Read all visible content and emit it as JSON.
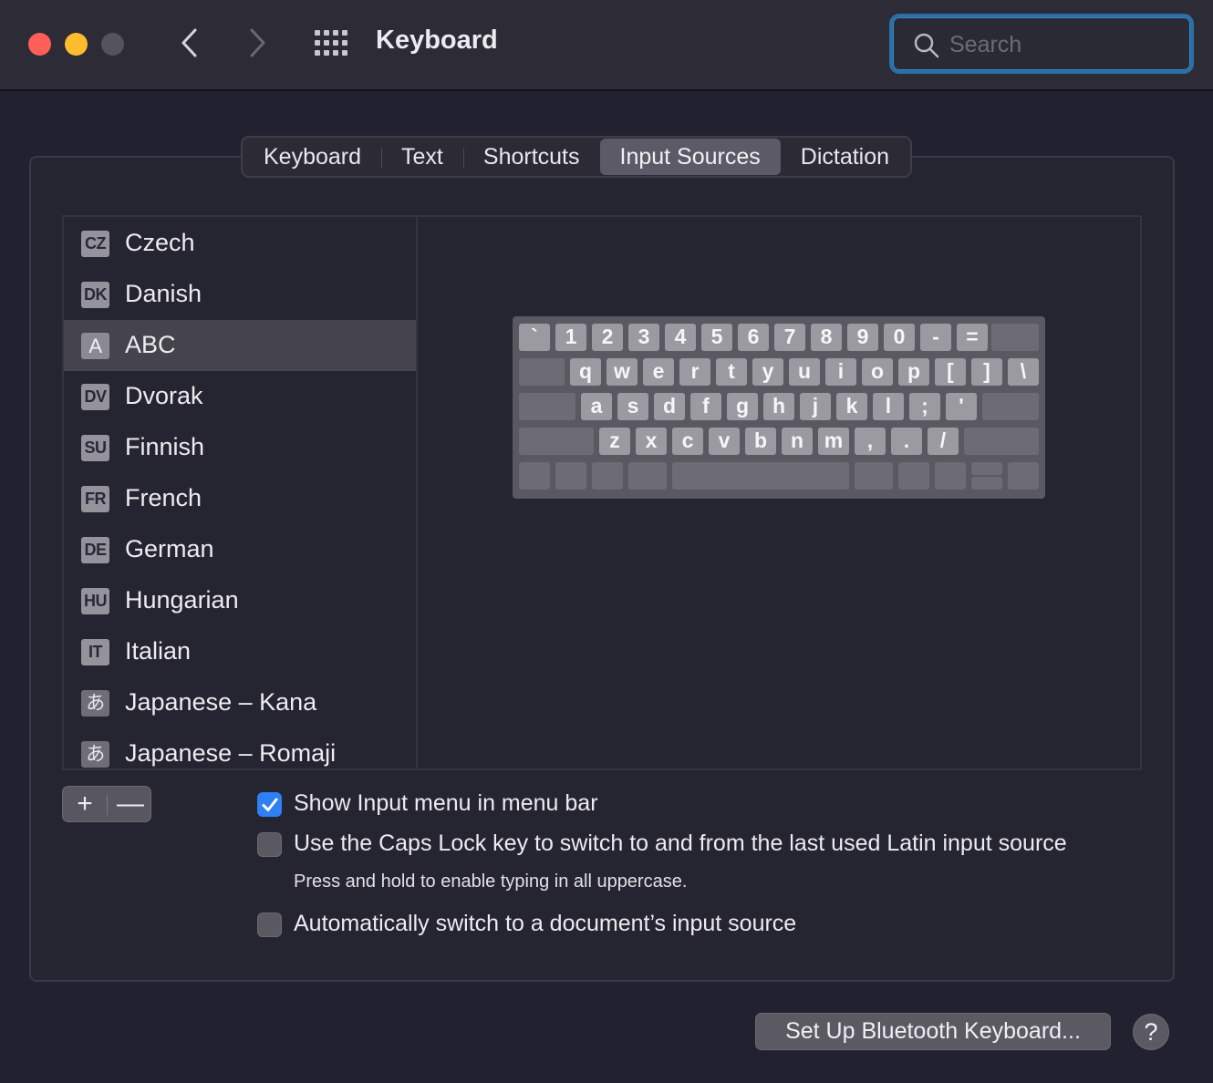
{
  "window": {
    "title": "Keyboard"
  },
  "search": {
    "placeholder": "Search",
    "value": ""
  },
  "tabs": [
    {
      "label": "Keyboard",
      "active": false
    },
    {
      "label": "Text",
      "active": false
    },
    {
      "label": "Shortcuts",
      "active": false
    },
    {
      "label": "Input Sources",
      "active": true
    },
    {
      "label": "Dictation",
      "active": false
    }
  ],
  "input_sources": [
    {
      "badge": "CZ",
      "label": "Czech"
    },
    {
      "badge": "DK",
      "label": "Danish"
    },
    {
      "badge": "A",
      "label": "ABC",
      "selected": true
    },
    {
      "badge": "DV",
      "label": "Dvorak"
    },
    {
      "badge": "SU",
      "label": "Finnish"
    },
    {
      "badge": "FR",
      "label": "French"
    },
    {
      "badge": "DE",
      "label": "German"
    },
    {
      "badge": "HU",
      "label": "Hungarian"
    },
    {
      "badge": "IT",
      "label": "Italian"
    },
    {
      "badge": "あ",
      "label": "Japanese – Kana"
    },
    {
      "badge": "あ",
      "label": "Japanese – Romaji"
    }
  ],
  "keyboard_rows": [
    [
      "`",
      "1",
      "2",
      "3",
      "4",
      "5",
      "6",
      "7",
      "8",
      "9",
      "0",
      "-",
      "="
    ],
    [
      "q",
      "w",
      "e",
      "r",
      "t",
      "y",
      "u",
      "i",
      "o",
      "p",
      "[",
      "]",
      "\\"
    ],
    [
      "a",
      "s",
      "d",
      "f",
      "g",
      "h",
      "j",
      "k",
      "l",
      ";",
      "'"
    ],
    [
      "z",
      "x",
      "c",
      "v",
      "b",
      "n",
      "m",
      ",",
      ".",
      "/"
    ]
  ],
  "list_controls": {
    "add": "+",
    "remove": "—"
  },
  "options": {
    "show_input_menu": {
      "label": "Show Input menu in menu bar",
      "checked": true
    },
    "caps_lock_switch": {
      "label": "Use the Caps Lock key to switch to and from the last used Latin input source",
      "checked": false,
      "note": "Press and hold to enable typing in all uppercase."
    },
    "auto_switch": {
      "label": "Automatically switch to a document’s input source",
      "checked": false
    }
  },
  "footer": {
    "bluetooth_label": "Set Up Bluetooth Keyboard...",
    "help_label": "?"
  },
  "colors": {
    "accent": "#2f7ff5",
    "search_focus": "#2a6fa8",
    "close": "#ff5f57",
    "minimize": "#febc2e"
  }
}
